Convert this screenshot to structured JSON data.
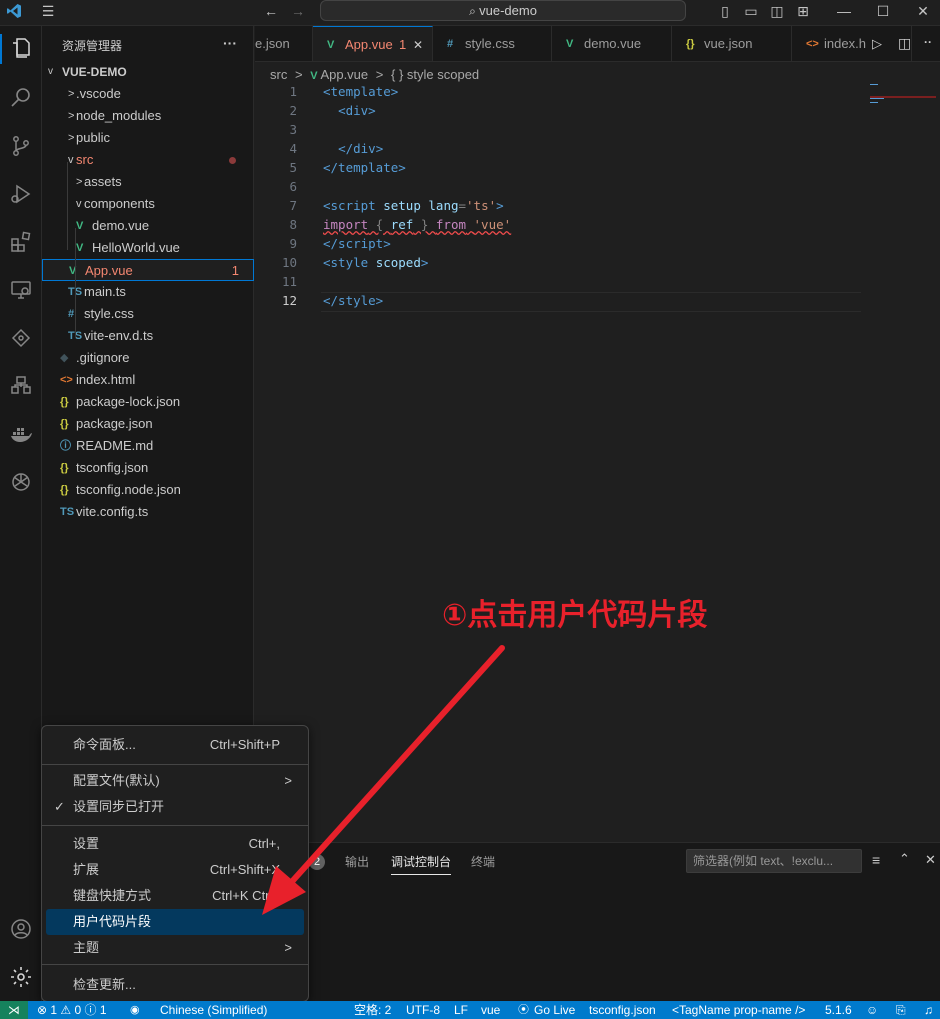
{
  "titlebar": {
    "search": "vue-demo"
  },
  "explorer": {
    "title": "资源管理器",
    "more": "···",
    "root": "VUE-DEMO",
    "items": [
      {
        "label": ".vscode",
        "icon": ">",
        "iconColor": "#cccccc"
      },
      {
        "label": "node_modules",
        "icon": ">",
        "iconColor": "#cccccc"
      },
      {
        "label": "public",
        "icon": ">",
        "iconColor": "#cccccc"
      },
      {
        "label": "src",
        "icon": "v",
        "iconColor": "#cccccc"
      },
      {
        "label": "assets",
        "icon": ">",
        "iconColor": "#cccccc"
      },
      {
        "label": "components",
        "icon": "v",
        "iconColor": "#cccccc"
      },
      {
        "label": "demo.vue",
        "icon": "V",
        "iconColor": "#41b883"
      },
      {
        "label": "HelloWorld.vue",
        "icon": "V",
        "iconColor": "#41b883"
      },
      {
        "label": "App.vue",
        "icon": "V",
        "iconColor": "#41b883",
        "badge": "1"
      },
      {
        "label": "main.ts",
        "icon": "TS",
        "iconColor": "#519aba"
      },
      {
        "label": "style.css",
        "icon": "#",
        "iconColor": "#519aba"
      },
      {
        "label": "vite-env.d.ts",
        "icon": "TS",
        "iconColor": "#519aba"
      },
      {
        "label": ".gitignore",
        "icon": "◆",
        "iconColor": "#41535b"
      },
      {
        "label": "index.html",
        "icon": "<>",
        "iconColor": "#e37933"
      },
      {
        "label": "package-lock.json",
        "icon": "{}",
        "iconColor": "#cbcb41"
      },
      {
        "label": "package.json",
        "icon": "{}",
        "iconColor": "#cbcb41"
      },
      {
        "label": "README.md",
        "icon": "ⓘ",
        "iconColor": "#519aba"
      },
      {
        "label": "tsconfig.json",
        "icon": "{}",
        "iconColor": "#cbcb41"
      },
      {
        "label": "tsconfig.node.json",
        "icon": "{}",
        "iconColor": "#cbcb41"
      },
      {
        "label": "vite.config.ts",
        "icon": "TS",
        "iconColor": "#519aba"
      }
    ]
  },
  "tabs": [
    {
      "label": "e.json",
      "icon": "",
      "iconColor": "#cbcb41"
    },
    {
      "label": "App.vue",
      "icon": "V",
      "iconColor": "#41b883",
      "badge": "1",
      "close": "✕",
      "active": true
    },
    {
      "label": "style.css",
      "icon": "#",
      "iconColor": "#519aba"
    },
    {
      "label": "demo.vue",
      "icon": "V",
      "iconColor": "#41b883"
    },
    {
      "label": "vue.json",
      "icon": "{}",
      "iconColor": "#cbcb41"
    },
    {
      "label": "index.h",
      "icon": "<>",
      "iconColor": "#e37933"
    }
  ],
  "breadcrumb": {
    "src": "src",
    "sep": ">",
    "file": "App.vue",
    "sep2": ">",
    "symbol": "{ } style scoped"
  },
  "code": {
    "lines": [
      "1",
      "2",
      "3",
      "4",
      "5",
      "6",
      "7",
      "8",
      "9",
      "10",
      "11",
      "12"
    ]
  },
  "panel": {
    "badge": "2",
    "tabs": [
      "输出",
      "调试控制台",
      "终端"
    ],
    "filter": "筛选器(例如 text、!exclu..."
  },
  "menu": {
    "items": [
      {
        "label": "命令面板...",
        "shortcut": "Ctrl+Shift+P"
      },
      {
        "label": "配置文件(默认)",
        "shortcut": ">"
      },
      {
        "label": "设置同步已打开",
        "shortcut": "",
        "check": "✓"
      },
      {
        "label": "设置",
        "shortcut": "Ctrl+,"
      },
      {
        "label": "扩展",
        "shortcut": "Ctrl+Shift+X"
      },
      {
        "label": "键盘快捷方式",
        "shortcut": "Ctrl+K Ctrl+"
      },
      {
        "label": "用户代码片段",
        "shortcut": ""
      },
      {
        "label": "主题",
        "shortcut": ">"
      },
      {
        "label": "检查更新...",
        "shortcut": ""
      }
    ]
  },
  "status": {
    "remote": "⋊",
    "problems": "⊗ 1 ⚠ 0 ⓘ 1",
    "language_pack": "Chinese (Simplified)",
    "spaces": "空格: 2",
    "encoding": "UTF-8",
    "eol": "LF",
    "mode": "vue",
    "golive": "Go Live",
    "tsconfig": "tsconfig.json",
    "tagname": "<TagName prop-name />",
    "version": "5.1.6"
  },
  "annotation": "①点击用户代码片段",
  "colors": {
    "accent": "#007acc",
    "annotation": "#e8212b",
    "menu_highlight": "#04395e"
  }
}
